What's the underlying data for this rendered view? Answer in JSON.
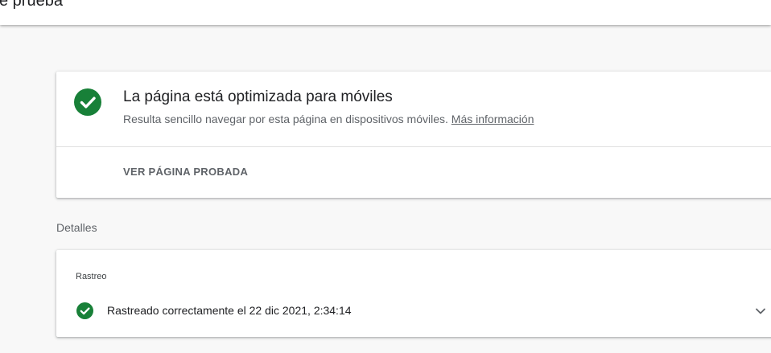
{
  "header": {
    "title": "e prueba"
  },
  "result": {
    "title": "La página está optimizada para móviles",
    "subtitle": "Resulta sencillo navegar por esta página en dispositivos móviles.",
    "more_info_link": "Más información",
    "view_tested_page_label": "VER PÁGINA PROBADA",
    "status_icon": "check-circle-icon"
  },
  "details": {
    "heading": "Detalles",
    "crawl": {
      "label": "Rastreo",
      "status": "Rastreado correctamente el 22 dic 2021, 2:34:14",
      "status_icon": "check-circle-icon",
      "expand_icon": "chevron-down-icon"
    }
  },
  "colors": {
    "success_green": "#188038",
    "page_background": "#f8f8f8",
    "card_background": "#ffffff",
    "secondary_text": "#5f6368"
  }
}
